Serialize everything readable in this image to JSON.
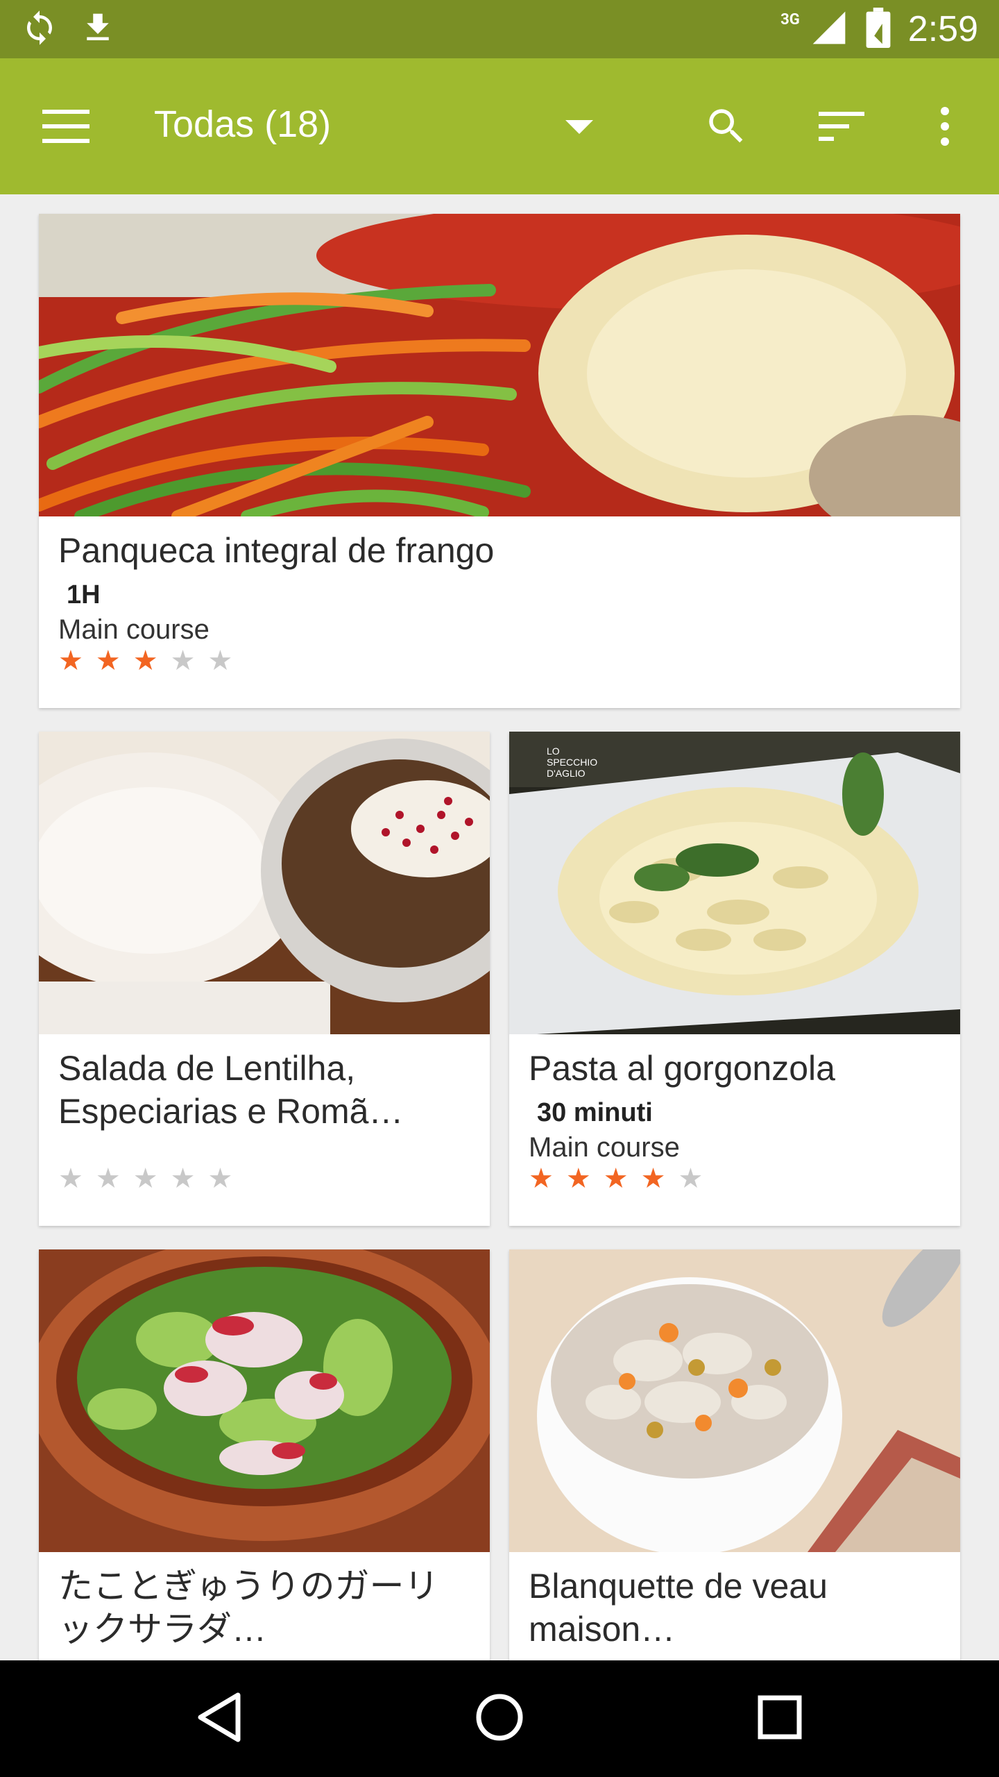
{
  "status_bar": {
    "time": "2:59",
    "network": "3G",
    "icons": [
      "sync-icon",
      "download-icon",
      "signal-icon",
      "battery-icon"
    ]
  },
  "toolbar": {
    "title": "Todas (18)",
    "icons": [
      "menu-icon",
      "dropdown-arrow-icon",
      "search-icon",
      "sort-icon",
      "more-vert-icon"
    ]
  },
  "recipes": [
    {
      "name": "Panqueca integral de frango",
      "time": "1H",
      "category": "Main course",
      "rating": 3,
      "max_rating": 5
    },
    {
      "name": "Salada de Lentilha, Especiarias e Romã…",
      "time": "",
      "category": "",
      "rating": 0,
      "max_rating": 5
    },
    {
      "name": "Pasta al gorgonzola",
      "time": "30 minuti",
      "category": "Main course",
      "rating": 4,
      "max_rating": 5
    },
    {
      "name": "たことぎゅうりのガーリックサラダ…",
      "time": "",
      "category": "",
      "rating": 0,
      "max_rating": 5
    },
    {
      "name": "Blanquette de veau maison…",
      "time": "",
      "category": "",
      "rating": 0,
      "max_rating": 5
    }
  ],
  "image_watermark": "LO SPECCHIO D'AGLIO",
  "nav_bar": {
    "icons": [
      "back-icon",
      "home-icon",
      "recents-icon"
    ]
  },
  "colors": {
    "status_bar": "#7a8f25",
    "toolbar": "#9fba2f",
    "star_on": "#f26522",
    "star_off": "#c8c8c8"
  }
}
